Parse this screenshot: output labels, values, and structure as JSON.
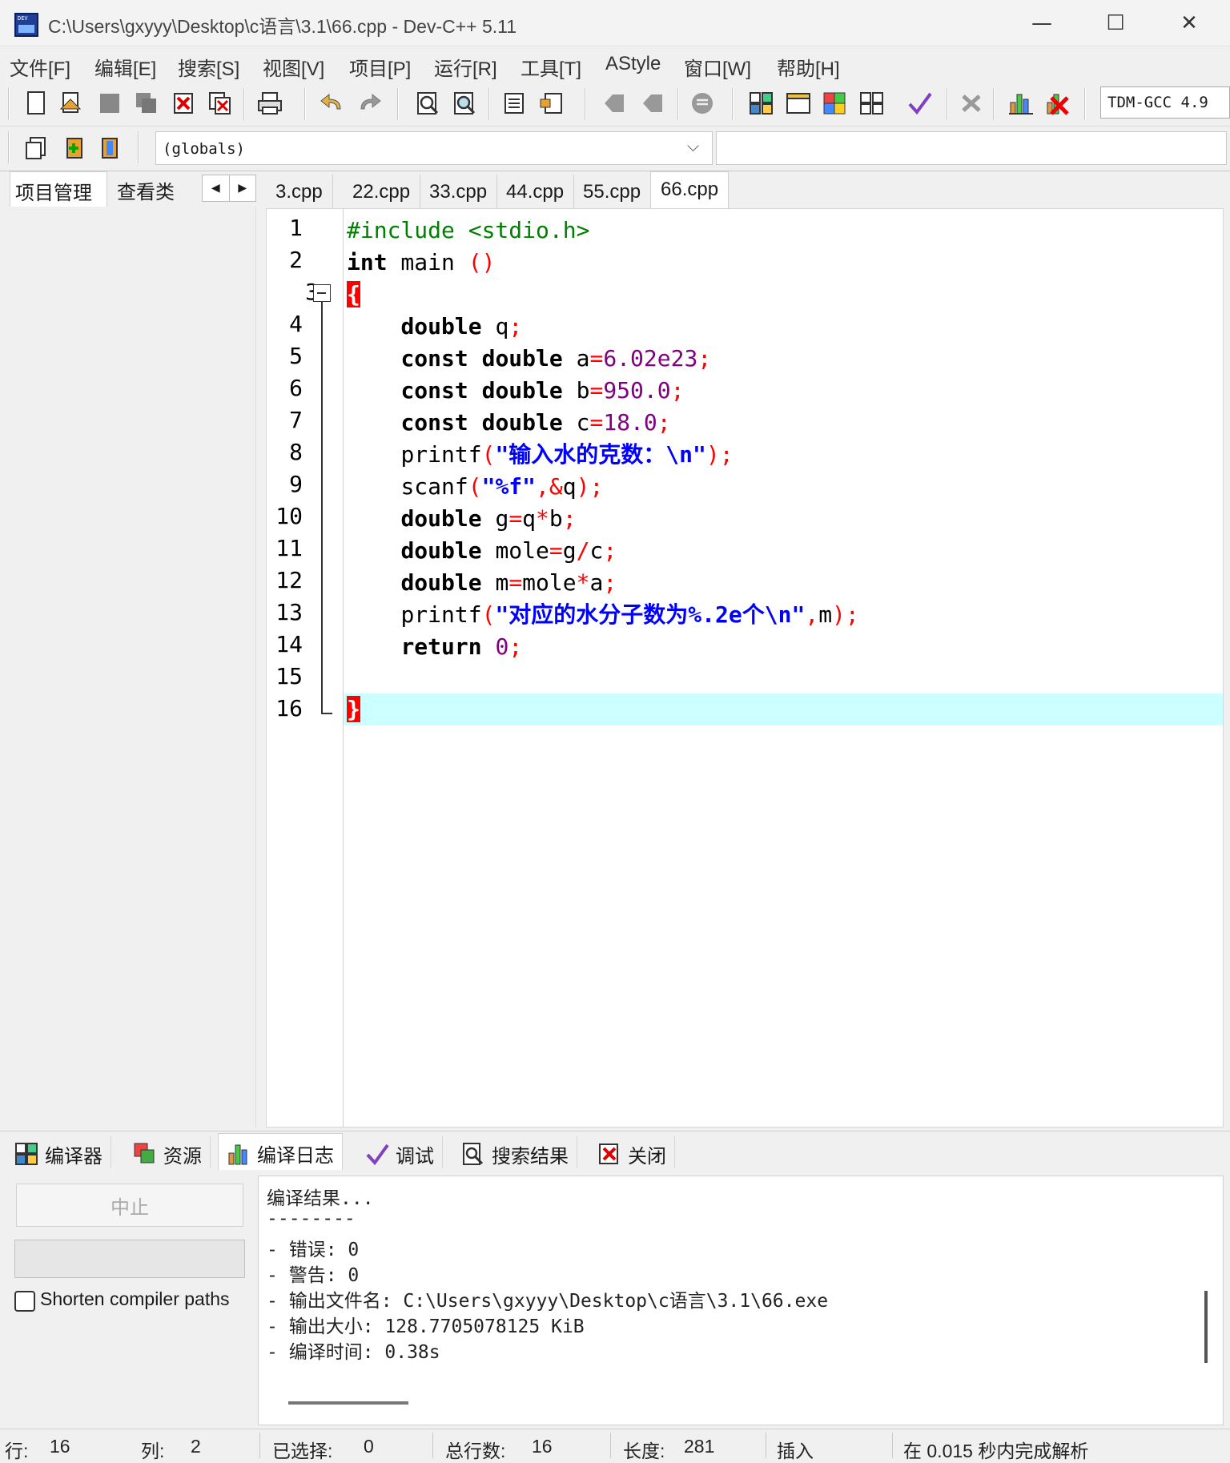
{
  "window": {
    "title": "C:\\Users\\gxyyy\\Desktop\\c语言\\3.1\\66.cpp - Dev-C++ 5.11",
    "minimize_glyph": "—",
    "maximize_glyph": "☐",
    "close_glyph": "✕"
  },
  "menu": [
    "文件[F]",
    "编辑[E]",
    "搜索[S]",
    "视图[V]",
    "项目[P]",
    "运行[R]",
    "工具[T]",
    "AStyle",
    "窗口[W]",
    "帮助[H]"
  ],
  "toolbar": {
    "compiler": "TDM-GCC 4.9",
    "scope": "(globals)",
    "nav_left": "◀",
    "nav_right": "▶",
    "dropdown_arrow": "⌵"
  },
  "left_tabs": [
    "项目管理",
    "查看类"
  ],
  "editor_tabs": [
    "3.cpp",
    "22.cpp",
    "33.cpp",
    "44.cpp",
    "55.cpp",
    "66.cpp"
  ],
  "active_tab": "66.cpp",
  "code": {
    "line_numbers": [
      "1",
      "2",
      "3",
      "4",
      "5",
      "6",
      "7",
      "8",
      "9",
      "10",
      "11",
      "12",
      "13",
      "14",
      "15",
      "16"
    ],
    "lines": {
      "l1": {
        "pp": "#include <stdio.h>"
      },
      "l2": {
        "kw": "int",
        "rest": " main ",
        "paren": "()"
      },
      "l3": {
        "brace": "{"
      },
      "l4": {
        "indent": "    ",
        "kw": "double",
        "rest": " q",
        "semi": ";"
      },
      "l5": {
        "indent": "    ",
        "kw": "const double",
        "rest": " a",
        "eq": "=",
        "num": "6.02e23",
        "semi": ";"
      },
      "l6": {
        "indent": "    ",
        "kw": "const double",
        "rest": " b",
        "eq": "=",
        "num": "950.0",
        "semi": ";"
      },
      "l7": {
        "indent": "    ",
        "kw": "const double",
        "rest": " c",
        "eq": "=",
        "num": "18.0",
        "semi": ";"
      },
      "l8": {
        "indent": "    ",
        "fn": "printf",
        "open": "(",
        "str": "\"输入水的克数：\\n\"",
        "close": ");"
      },
      "l9": {
        "indent": "    ",
        "fn": "scanf",
        "open": "(",
        "str": "\"%f\"",
        "comma": ",&",
        "var": "q",
        "close": ");"
      },
      "l10": {
        "indent": "    ",
        "kw": "double",
        "a": " g",
        "op1": "=",
        "b": "q",
        "op2": "*",
        "c": "b",
        "semi": ";"
      },
      "l11": {
        "indent": "    ",
        "kw": "double",
        "a": " mole",
        "op1": "=",
        "b": "g",
        "op2": "/",
        "c": "c",
        "semi": ";"
      },
      "l12": {
        "indent": "    ",
        "kw": "double",
        "a": " m",
        "op1": "=",
        "b": "mole",
        "op2": "*",
        "c": "a",
        "semi": ";"
      },
      "l13": {
        "indent": "    ",
        "fn": "printf",
        "open": "(",
        "str": "\"对应的水分子数为%.2e个\\n\"",
        "comma": ",",
        "var": "m",
        "close": ");"
      },
      "l14": {
        "indent": "    ",
        "kw": "return",
        "sp": " ",
        "num": "0",
        "semi": ";"
      },
      "l15": {},
      "l16": {
        "brace": "}"
      }
    }
  },
  "bottom_tabs": [
    "编译器",
    "资源",
    "编译日志",
    "调试",
    "搜索结果",
    "关闭"
  ],
  "bottom_panel": {
    "stop_button": "中止",
    "shorten_label": "Shorten compiler paths",
    "log": [
      "编译结果...",
      "--------",
      "- 错误: 0",
      "- 警告: 0",
      "- 输出文件名: C:\\Users\\gxyyy\\Desktop\\c语言\\3.1\\66.exe",
      "- 输出大小: 128.7705078125 KiB",
      "- 编译时间: 0.38s"
    ]
  },
  "status": {
    "row_label": "行:",
    "row_value": "16",
    "col_label": "列:",
    "col_value": "2",
    "sel_label": "已选择:",
    "sel_value": "0",
    "lines_label": "总行数:",
    "lines_value": "16",
    "len_label": "长度:",
    "len_value": "281",
    "mode": "插入",
    "parse": "在 0.015 秒内完成解析"
  },
  "colors": {
    "keyword": "#000000",
    "preprocessor": "#008000",
    "symbol": "#ff0000",
    "number": "#800080",
    "string": "#0000ff",
    "current_line": "#ccffff",
    "brace_match": "#ff0000"
  }
}
